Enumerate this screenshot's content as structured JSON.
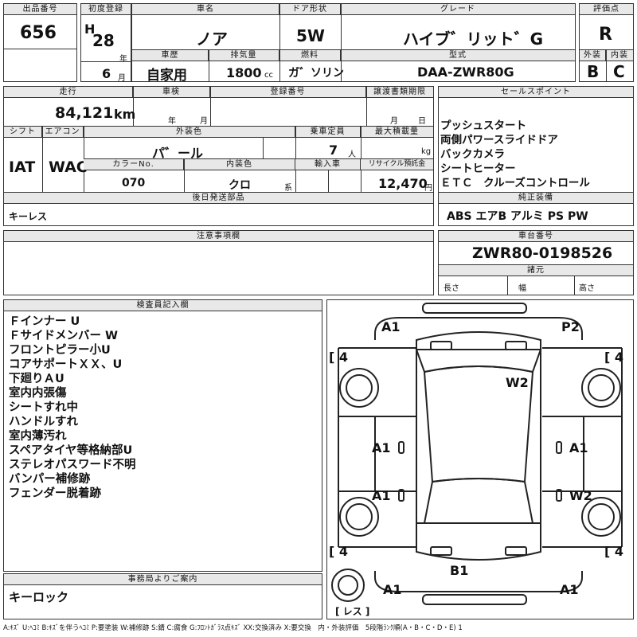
{
  "header": {
    "lot_label": "出品番号",
    "lot": "656",
    "first_reg_label": "初度登録",
    "era": "H",
    "year": "28",
    "year_unit": "年",
    "month": "6",
    "month_unit": "月",
    "name_label": "車名",
    "name": "ノア",
    "door_label": "ドア形状",
    "door": "5W",
    "grade_label": "グレード",
    "grade": "ハイブ゛リット゛G",
    "score_label": "評価点",
    "score": "R",
    "history_label": "車歴",
    "history": "自家用",
    "disp_label": "排気量",
    "disp": "1800",
    "disp_unit": "cc",
    "fuel_label": "燃料",
    "fuel": "ガ゛ソリン",
    "model_label": "型式",
    "model": "DAA-ZWR80G",
    "ext_label": "外装",
    "ext": "B",
    "int_label": "内装",
    "int": "C"
  },
  "row2": {
    "mileage_label": "走行",
    "mileage": "84,121",
    "mileage_unit": "km",
    "inspection_label": "車検",
    "insp_year_unit": "年",
    "insp_month_unit": "月",
    "plate_label": "登録番号",
    "transfer_label": "譲渡書類期限",
    "transfer_month_unit": "月",
    "transfer_day_unit": "日",
    "shift_label": "シフト",
    "shift": "IAT",
    "ac_label": "エアコン",
    "ac": "WAC",
    "color_label": "外装色",
    "color": "パ゛ール",
    "capacity_label": "乗車定員",
    "capacity": "7",
    "capacity_unit": "人",
    "load_label": "最大積載量",
    "load_unit": "kg",
    "color_no_label": "カラーNo.",
    "color_no": "070",
    "int_color_label": "内装色",
    "int_color": "クロ",
    "int_color_unit": "系",
    "import_label": "輸入車",
    "recycle_label": "リサイクル預託金",
    "recycle": "12,470",
    "recycle_unit": "円",
    "later_label": "後日発送部品",
    "later": "キーレス"
  },
  "sales": {
    "label": "セールスポイント",
    "items": [
      "プッシュスタート",
      "両側パワースライドドア",
      "バックカメラ",
      "シートヒーター",
      "ＥＴＣ　クルーズコントロール"
    ],
    "equip_label": "純正装備",
    "equip": "ABS エアB アルミ PS PW"
  },
  "notes": {
    "label": "注意事項欄"
  },
  "chassis": {
    "label": "車台番号",
    "number": "ZWR80-0198526",
    "spec_label": "諸元",
    "length": "長さ",
    "width": "幅",
    "height": "高さ"
  },
  "inspector": {
    "label": "検査員記入欄",
    "items": [
      "Ｆインナー U",
      "Ｆサイドメンバー W",
      "フロントピラー小U",
      "コアサポートＸＸ、U",
      "下廻りＡU",
      "室内内張傷",
      "シートすれ中",
      "ハンドルすれ",
      "室内薄汚れ",
      "スペアタイヤ等格納部U",
      "ステレオパスワード不明",
      "バンパー補修跡",
      "フェンダー脱着跡"
    ]
  },
  "office": {
    "label": "事務局よりご案内",
    "text": "キーロック"
  },
  "diagram": {
    "marks": [
      "A1",
      "P2",
      "W2",
      "A1",
      "A1",
      "A1",
      "W2",
      "B1",
      "A1",
      "A1"
    ],
    "tires": [
      "4",
      "4",
      "4",
      "4"
    ],
    "spare": "レス"
  },
  "legend": "A:ｷｽﾞ U:ﾍｺﾐ B:ｷｽﾞを伴うﾍｺﾐ P:要塗装 W:補修跡 S:錆 C:腐食 G:ﾌﾛﾝﾄｶﾞﾗｽ点ｷｽﾞ XX:交換済み X:要交換　内・外装評価　5段階ﾗﾝｸ順(A・B・C・D・E) 1"
}
